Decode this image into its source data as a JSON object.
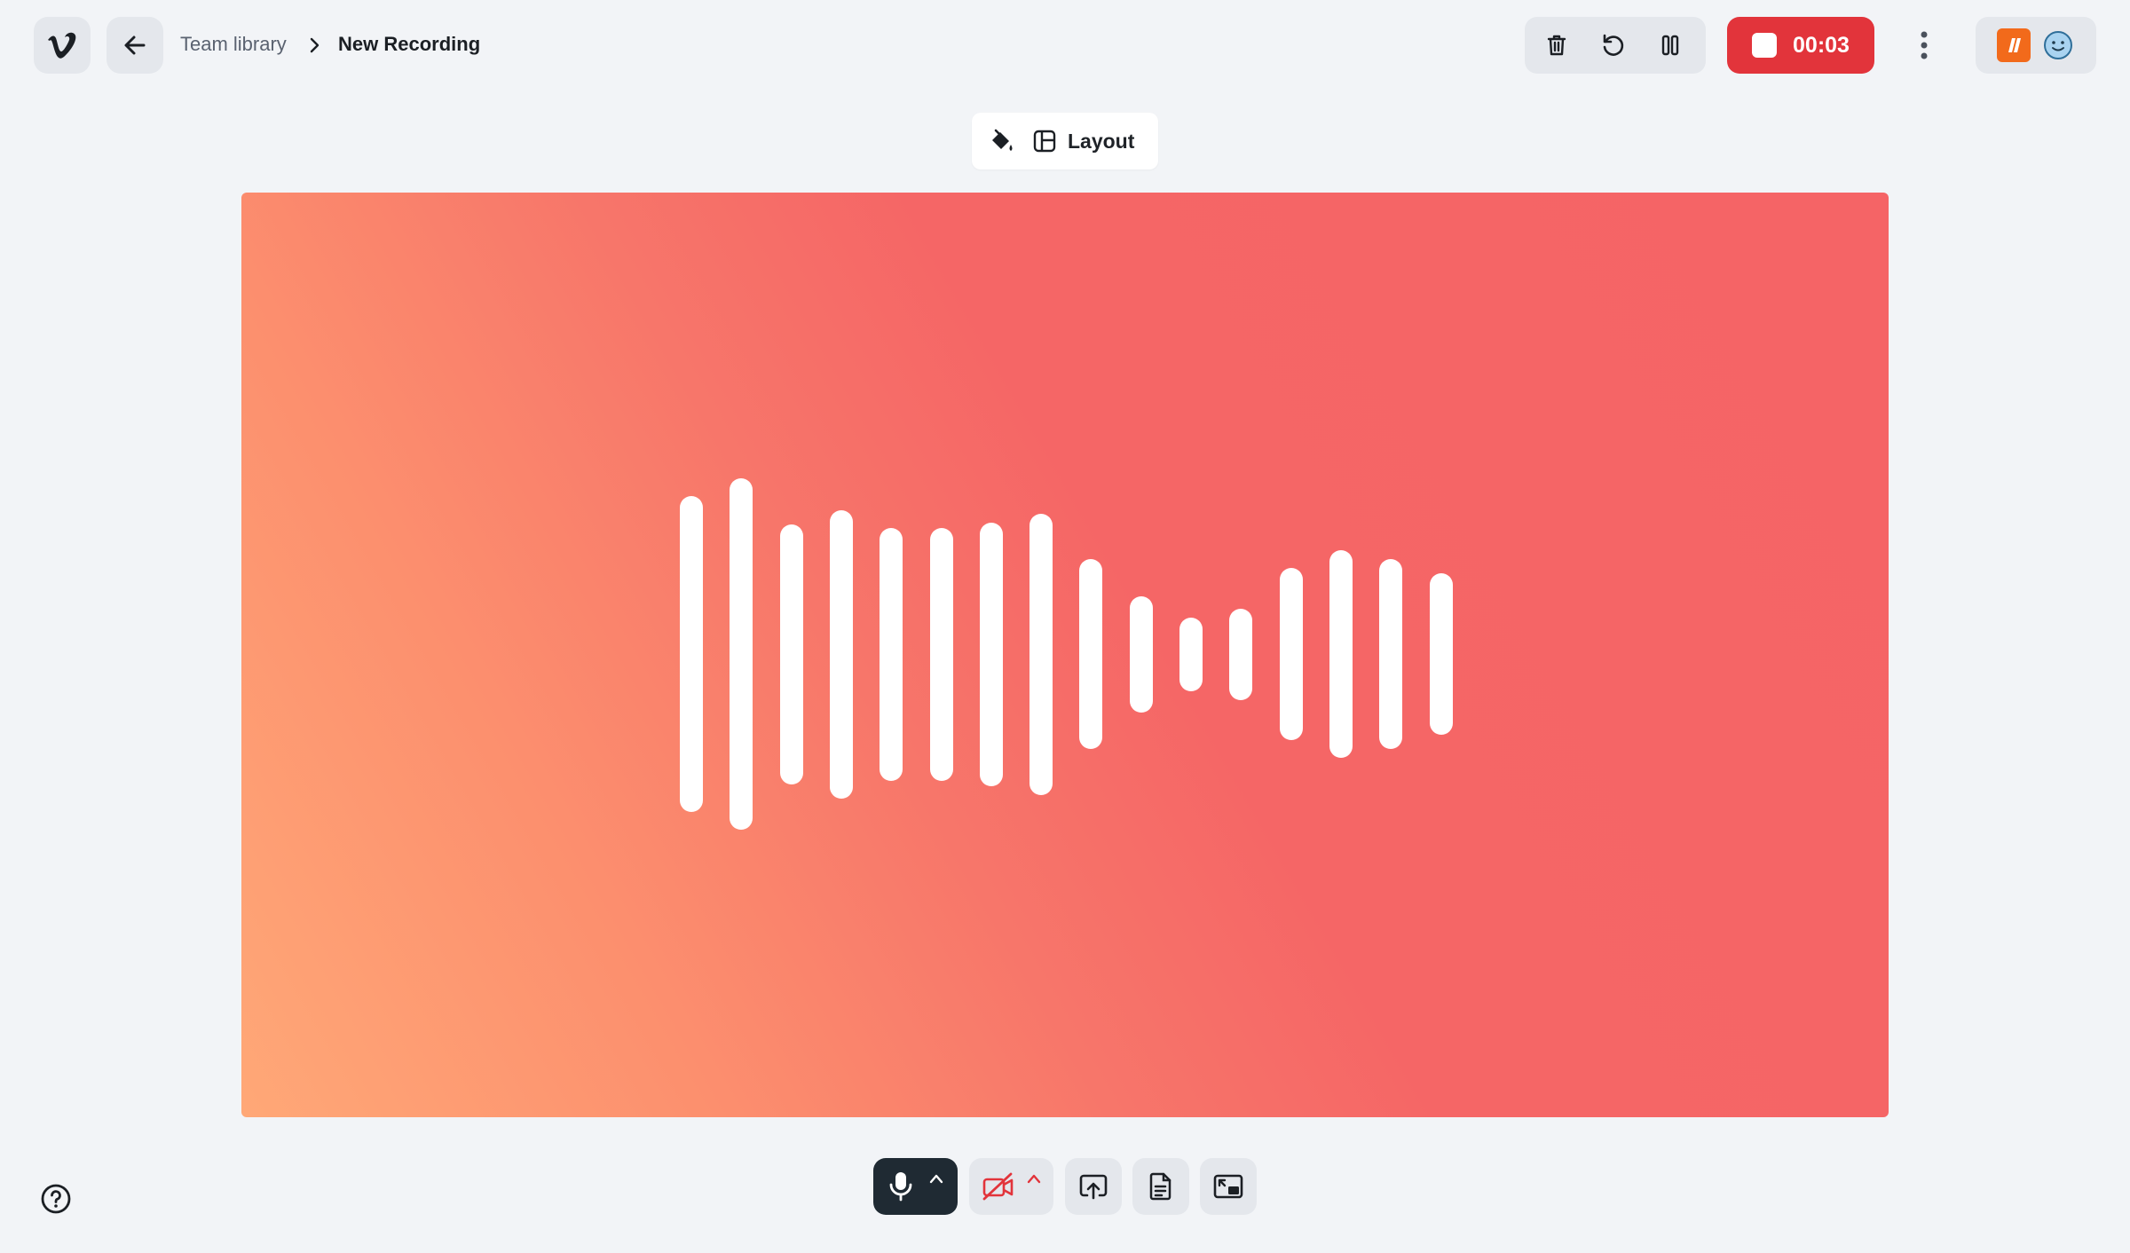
{
  "header": {
    "logo_icon": "vimeo-logo",
    "back_icon": "arrow-left-icon",
    "breadcrumb": {
      "parent": "Team library",
      "separator_icon": "chevron-right-icon",
      "current": "New Recording"
    },
    "controls": {
      "delete_icon": "trash-icon",
      "restart_icon": "rotate-ccw-icon",
      "pause_icon": "pause-icon"
    },
    "recording": {
      "timer": "00:03",
      "stop_icon": "stop-square-icon",
      "color": "#e2343b"
    },
    "more_icon": "more-vertical-icon",
    "extensions": [
      "brand-extension-icon",
      "smiley-avatar-icon"
    ]
  },
  "toolbar": {
    "background_icon": "paint-bucket-icon",
    "layout_icon": "layout-icon",
    "layout_label": "Layout"
  },
  "stage": {
    "gradient_start": "#ffa877",
    "gradient_end": "#f56466",
    "visualizer": {
      "type": "audio-waveform",
      "levels": [
        0.9,
        1.0,
        0.74,
        0.82,
        0.72,
        0.72,
        0.75,
        0.8,
        0.54,
        0.33,
        0.21,
        0.26,
        0.49,
        0.59,
        0.54,
        0.46
      ]
    }
  },
  "bottom_bar": {
    "mic_icon": "microphone-icon",
    "mic_menu_icon": "chevron-up-icon",
    "camera_icon": "camera-off-icon",
    "camera_menu_icon": "chevron-up-icon",
    "share_screen_icon": "screen-share-icon",
    "notes_icon": "document-icon",
    "pip_icon": "picture-in-picture-icon"
  },
  "help_icon": "help-circle-icon"
}
